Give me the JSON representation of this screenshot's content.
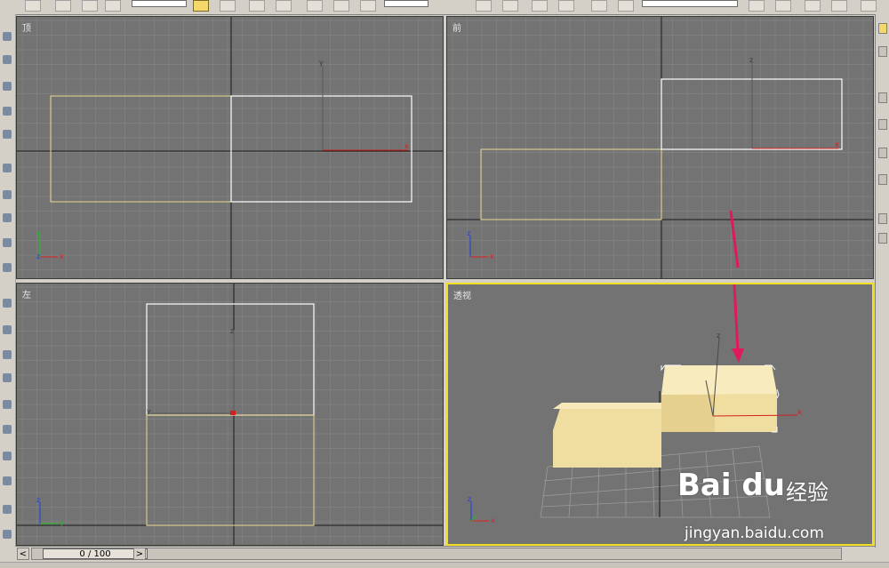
{
  "viewports": {
    "top": {
      "label": "顶"
    },
    "front": {
      "label": "前"
    },
    "left": {
      "label": "左"
    },
    "perspective": {
      "label": "透视"
    }
  },
  "timeline": {
    "frame_display": "0 / 100",
    "prev_arrow": "<",
    "next_arrow": ">"
  },
  "watermark": {
    "logo": "Bai du",
    "product": "经验",
    "url": "jingyan.baidu.com"
  },
  "colors": {
    "viewport_bg": "#737373",
    "grid": "#838383",
    "axis": "#1a1a1a",
    "selected_outline": "#ffffff",
    "object_outline": "#e8d890",
    "box_fill": "#f0dea0",
    "active_border": "#f0e020",
    "arrow": "#e01a5a",
    "gizmo_x": "#e02020",
    "gizmo_y": "#20c020",
    "gizmo_z": "#2040e0"
  },
  "icons": [
    "select-arrow-icon",
    "move-icon",
    "rotate-icon",
    "scale-icon",
    "axis-tripod-icon",
    "red-arrow-annotation"
  ]
}
